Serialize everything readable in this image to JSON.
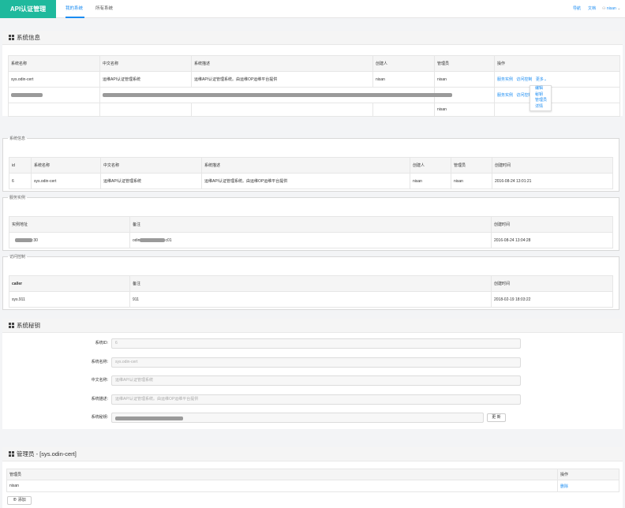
{
  "nav": {
    "brand": "API认证管理",
    "tabs": [
      "我的系统",
      "所有系统"
    ],
    "links": [
      "导航",
      "文档"
    ],
    "user": "nisan"
  },
  "system_info": {
    "title": "系统信息",
    "headers": [
      "系统名称",
      "中文名称",
      "系统描述",
      "创建人",
      "管理员",
      "操作"
    ],
    "row": [
      "sys.odin-cert",
      "运维API认证管理系统",
      "运维API认证管理系统。由运维OP运维平台提供",
      "nisan",
      "nisan"
    ],
    "row3_admin": "nisan",
    "ops": [
      "服务实例",
      "访问控制",
      "更多"
    ],
    "more_menu": [
      "编辑",
      "秘钥",
      "管理员",
      "详情"
    ]
  },
  "detail_info": {
    "legend": "系统信息",
    "headers": [
      "id",
      "系统名称",
      "中文名称",
      "系统描述",
      "创建人",
      "管理员",
      "创建时间"
    ],
    "row": [
      "6",
      "sys.odin-cert",
      "运维API认证管理系统",
      "运维API认证管理系统。由运维OP运维平台提供",
      "nisan",
      "nisan",
      "2016-08-24 13:01:21"
    ]
  },
  "service_instance": {
    "legend": "服务实例",
    "headers": [
      "实例地址",
      "备注",
      "创建时间"
    ],
    "row": [
      ":30",
      "odin",
      "c01",
      "2016-08-24 13:04:28"
    ]
  },
  "access_control": {
    "legend": "访问控制",
    "headers": [
      "caller",
      "备注",
      "创建时间"
    ],
    "row": [
      "sys.911",
      "911",
      "2018-02-19 18:03:22"
    ]
  },
  "system_secret": {
    "title": "系统秘钥",
    "labels": [
      "系统ID:",
      "系统名称:",
      "中文名称:",
      "系统描述:",
      "系统秘钥:"
    ],
    "values": [
      "6",
      "sys.odin-cert",
      "运维API认证管理系统",
      "运维API认证管理系统。由运维OP运维平台提供"
    ],
    "update_label": "更 新"
  },
  "admins": {
    "title": "管理员 - [sys.odin-cert]",
    "headers": [
      "管理员",
      "操作"
    ],
    "row": [
      "nisan",
      "删除"
    ],
    "add_label": "添加"
  },
  "colors": {
    "brand": "#1fb99d",
    "accent": "#1a8cf2"
  },
  "icons": [
    "grid-icon",
    "user-icon",
    "chevron-down-icon",
    "plus-circle-icon"
  ]
}
